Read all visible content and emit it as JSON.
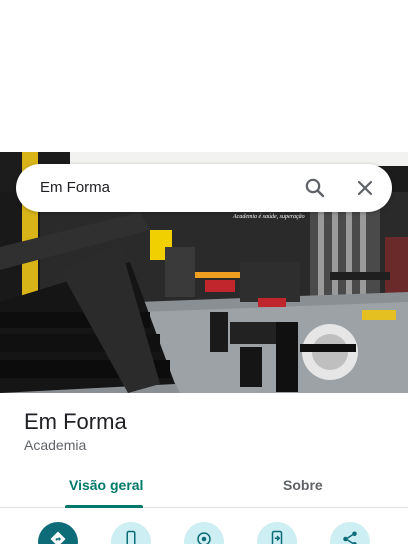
{
  "search": {
    "query": "Em Forma"
  },
  "place": {
    "name": "Em Forma",
    "category": "Academia",
    "photo_lettering": "Academia é saúde, superação"
  },
  "tabs": [
    {
      "label": "Visão geral",
      "active": true
    },
    {
      "label": "Sobre",
      "active": false
    }
  ],
  "actions": [
    {
      "icon": "directions-icon"
    },
    {
      "icon": "phone-icon"
    },
    {
      "icon": "nearby-icon"
    },
    {
      "icon": "send-to-phone-icon"
    },
    {
      "icon": "share-icon"
    }
  ],
  "colors": {
    "accent": "#00796b",
    "primary_action": "#0e6b78",
    "secondary_action": "#cdeef2",
    "text": "#202124",
    "muted": "#5f6368"
  }
}
